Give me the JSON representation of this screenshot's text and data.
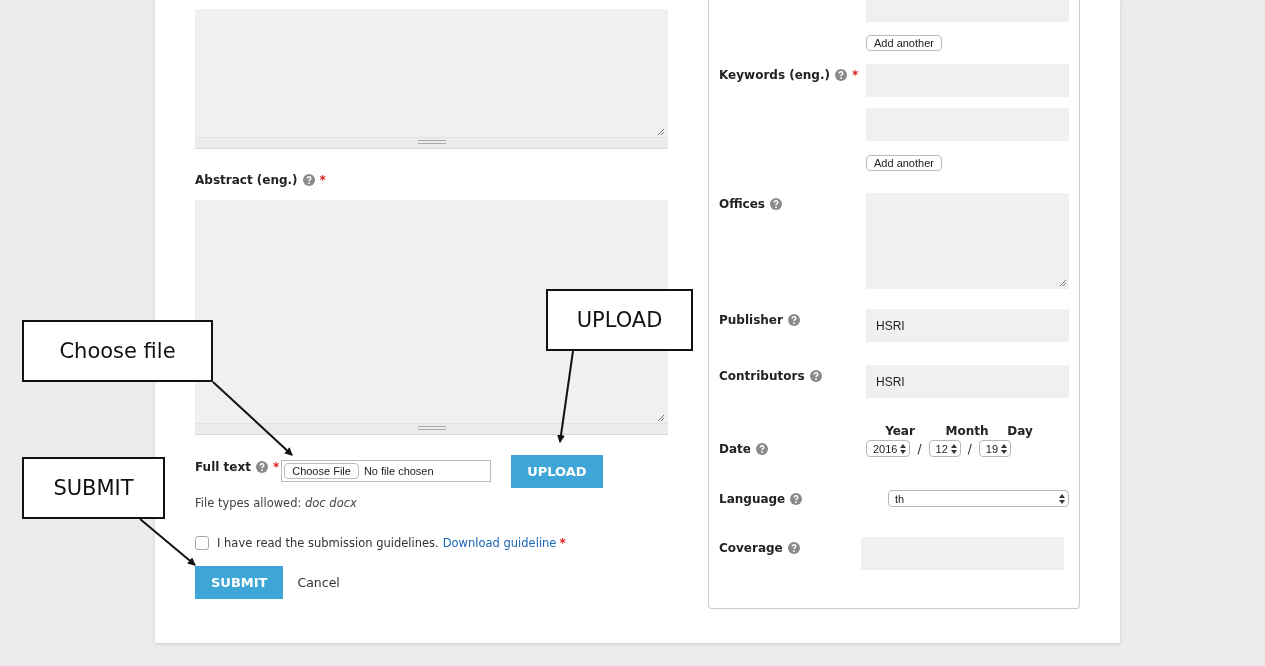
{
  "left": {
    "abstract": {
      "label": "Abstract (eng.)",
      "required_mark": "*"
    },
    "full_text": {
      "label": "Full text",
      "required_mark": "*",
      "choose_button": "Choose File",
      "file_status": "No file chosen",
      "upload_button": "UPLOAD",
      "hint": "File types allowed: ",
      "hint_types": "doc docx"
    },
    "agreement": {
      "checked": false,
      "text": "I have read the submission guidelines.",
      "link": "Download guideline",
      "required_mark": "*"
    },
    "buttons": [
      {
        "kind": "primary",
        "label": "SUBMIT"
      },
      {
        "kind": "link",
        "label": "Cancel"
      }
    ]
  },
  "right": {
    "top_add_button": "Add another",
    "rows": [
      {
        "kind": "multi",
        "label": "Keywords (eng.)",
        "required_mark": "*",
        "inputs": [
          {
            "kind": "text"
          },
          {
            "kind": "text"
          }
        ],
        "add_button": "Add another"
      },
      {
        "kind": "textarea",
        "label": "Offices"
      },
      {
        "kind": "text",
        "label": "Publisher",
        "value": "HSRI"
      },
      {
        "kind": "text",
        "label": "Contributors",
        "value": "HSRI"
      },
      {
        "kind": "date",
        "label": "Date",
        "parts": [
          {
            "heading": "Year",
            "value": "2016"
          },
          {
            "heading": "Month",
            "value": "12"
          },
          {
            "heading": "Day",
            "value": "19"
          }
        ],
        "separator": "/"
      },
      {
        "kind": "select",
        "label": "Language",
        "value": "th"
      },
      {
        "kind": "coverage",
        "label": "Coverage"
      }
    ]
  },
  "callouts": [
    {
      "text": "Choose file"
    },
    {
      "text": "UPLOAD"
    },
    {
      "text": "SUBMIT"
    }
  ]
}
